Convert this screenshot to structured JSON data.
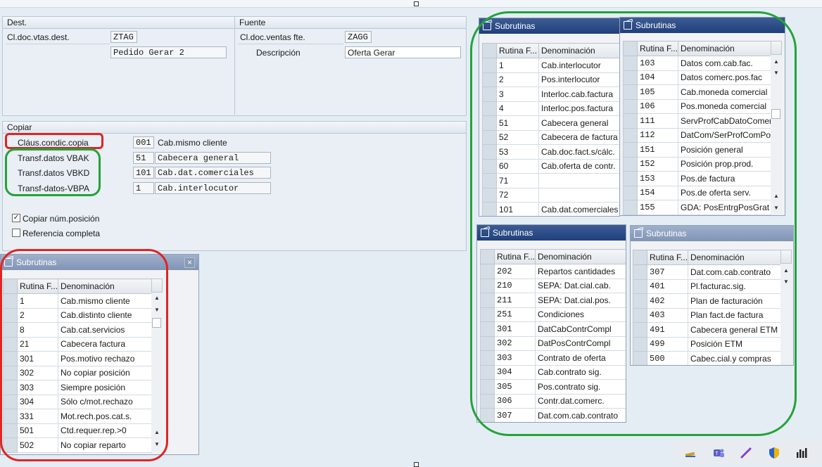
{
  "dest": {
    "title": "Dest.",
    "doc_label": "Cl.doc.vtas.dest.",
    "doc_value": "ZTAG",
    "desc_value": "Pedido Gerar 2"
  },
  "fuente": {
    "title": "Fuente",
    "doc_label": "Cl.doc.ventas fte.",
    "doc_value": "ZAGG",
    "desc_label": "Descripción",
    "desc_value": "Oferta Gerar"
  },
  "copiar": {
    "title": "Copiar",
    "rows": [
      {
        "label": "Cláus.condic.copia",
        "code": "001",
        "desc": "Cab.mismo cliente"
      },
      {
        "label": "Transf.datos VBAK",
        "code": "51",
        "desc": "Cabecera general"
      },
      {
        "label": "Transf.datos VBKD",
        "code": "101",
        "desc": "Cab.dat.comerciales"
      },
      {
        "label": "Transf-datos-VBPA",
        "code": "1",
        "desc": "Cab.interlocutor"
      }
    ],
    "checkbox_copy": {
      "label": "Copiar núm.posición",
      "checked": true,
      "mark": "✓"
    },
    "checkbox_ref": {
      "label": "Referencia completa",
      "checked": false
    }
  },
  "headers": {
    "rutina": "Rutina F...",
    "denominacion": "Denominación"
  },
  "popup_left": {
    "title": "Subrutinas",
    "close": "×",
    "rows": [
      {
        "code": "1",
        "name": "Cab.mismo cliente"
      },
      {
        "code": "2",
        "name": "Cab.distinto cliente"
      },
      {
        "code": "8",
        "name": "Cab.cat.servicios"
      },
      {
        "code": "21",
        "name": "Cabecera factura"
      },
      {
        "code": "301",
        "name": "Pos.motivo rechazo"
      },
      {
        "code": "302",
        "name": "No copiar posición"
      },
      {
        "code": "303",
        "name": "Siempre posición"
      },
      {
        "code": "304",
        "name": "Sólo c/mot.rechazo"
      },
      {
        "code": "331",
        "name": "Mot.rech.pos.cat.s."
      },
      {
        "code": "501",
        "name": "Ctd.requer.rep.>0"
      },
      {
        "code": "502",
        "name": "No copiar reparto"
      }
    ]
  },
  "popup_a": {
    "title": "Subrutinas",
    "rows": [
      {
        "code": "1",
        "name": "Cab.interlocutor"
      },
      {
        "code": "2",
        "name": "Pos.interlocutor"
      },
      {
        "code": "3",
        "name": "Interloc.cab.factura"
      },
      {
        "code": "4",
        "name": "Interloc.pos.factura"
      },
      {
        "code": "51",
        "name": "Cabecera general"
      },
      {
        "code": "52",
        "name": "Cabecera de factura"
      },
      {
        "code": "53",
        "name": "Cab.doc.fact.s/cálc."
      },
      {
        "code": "60",
        "name": "Cab.oferta de contr."
      },
      {
        "code": "71",
        "name": ""
      },
      {
        "code": "72",
        "name": ""
      },
      {
        "code": "101",
        "name": "Cab.dat.comerciales"
      }
    ]
  },
  "popup_b": {
    "title": "Subrutinas",
    "rows": [
      {
        "code": "103",
        "name": "Datos com.cab.fac."
      },
      {
        "code": "104",
        "name": "Datos comerc.pos.fac"
      },
      {
        "code": "105",
        "name": "Cab.moneda comercial"
      },
      {
        "code": "106",
        "name": "Pos.moneda comercial"
      },
      {
        "code": "111",
        "name": "ServProfCabDatoComer"
      },
      {
        "code": "112",
        "name": "DatCom/SerProfComPos"
      },
      {
        "code": "151",
        "name": "Posición general"
      },
      {
        "code": "152",
        "name": "Posición prop.prod."
      },
      {
        "code": "153",
        "name": "Pos.de factura"
      },
      {
        "code": "154",
        "name": "Pos.de oferta serv."
      },
      {
        "code": "155",
        "name": "GDA: PosEntrgPosGrat"
      }
    ]
  },
  "popup_c": {
    "title": "Subrutinas",
    "rows": [
      {
        "code": "202",
        "name": "Repartos cantidades"
      },
      {
        "code": "210",
        "name": "SEPA: Dat.cial.cab."
      },
      {
        "code": "211",
        "name": "SEPA: Dat.cial.pos."
      },
      {
        "code": "251",
        "name": "Condiciones"
      },
      {
        "code": "301",
        "name": "DatCabContrCompl"
      },
      {
        "code": "302",
        "name": "DatPosContrCompl"
      },
      {
        "code": "303",
        "name": "Contrato de oferta"
      },
      {
        "code": "304",
        "name": "Cab.contrato sig."
      },
      {
        "code": "305",
        "name": "Pos.contrato sig."
      },
      {
        "code": "306",
        "name": "Contr.dat.comerc."
      },
      {
        "code": "307",
        "name": "Dat.com.cab.contrato"
      }
    ]
  },
  "popup_d": {
    "title": "Subrutinas",
    "rows": [
      {
        "code": "307",
        "name": "Dat.com.cab.contrato"
      },
      {
        "code": "401",
        "name": "Pl.facturac.sig."
      },
      {
        "code": "402",
        "name": "Plan de facturación"
      },
      {
        "code": "403",
        "name": "Plan fact.de factura"
      },
      {
        "code": "491",
        "name": "Cabecera general ETM"
      },
      {
        "code": "499",
        "name": "Posición ETM"
      },
      {
        "code": "500",
        "name": "Cabec.cial.y compras"
      }
    ]
  },
  "colors": {
    "annotation_red": "#e02424",
    "annotation_green": "#23a33a",
    "title_dark": "#2a4a86",
    "title_light": "#8a9cbc"
  },
  "tray_icons": [
    "pen-tool-icon",
    "teams-icon",
    "stylus-icon",
    "shield-icon",
    "chart-bars-icon"
  ]
}
